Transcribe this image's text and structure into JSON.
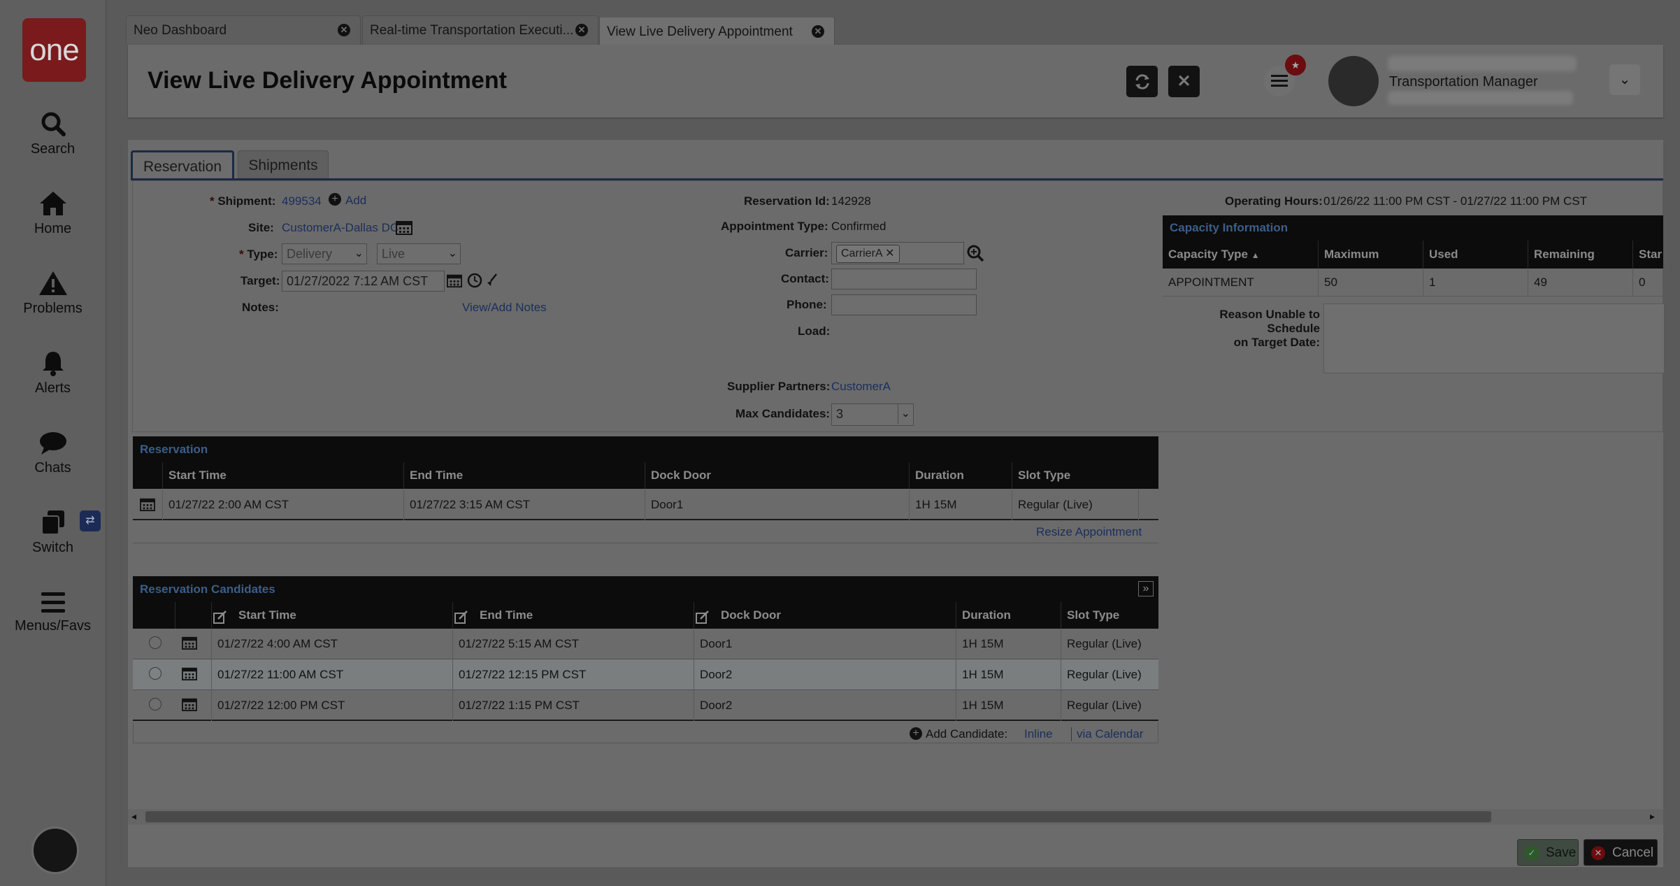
{
  "nav": {
    "logo": "one",
    "items": [
      {
        "label": "Search",
        "icon": "search-icon"
      },
      {
        "label": "Home",
        "icon": "home-icon"
      },
      {
        "label": "Problems",
        "icon": "warning-icon"
      },
      {
        "label": "Alerts",
        "icon": "bell-icon"
      },
      {
        "label": "Chats",
        "icon": "chat-icon"
      },
      {
        "label": "Switch",
        "icon": "switch-icon"
      },
      {
        "label": "Menus/Favs",
        "icon": "menu-icon"
      }
    ]
  },
  "tabs": [
    {
      "label": "Neo Dashboard"
    },
    {
      "label": "Real-time Transportation Executi..."
    },
    {
      "label": "View Live Delivery Appointment"
    }
  ],
  "header": {
    "title": "View Live Delivery Appointment",
    "user_role": "Transportation Manager"
  },
  "subtabs": [
    "Reservation",
    "Shipments"
  ],
  "form": {
    "shipment_label": "Shipment:",
    "shipment_value": "499534",
    "add_label": "Add",
    "site_label": "Site:",
    "site_value": "CustomerA-Dallas DC",
    "type_label": "Type:",
    "type_value1": "Delivery",
    "type_value2": "Live",
    "target_label": "Target:",
    "target_value": "01/27/2022 7:12 AM CST",
    "notes_label": "Notes:",
    "notes_link": "View/Add Notes",
    "reservation_id_label": "Reservation Id:",
    "reservation_id_value": "142928",
    "appointment_type_label": "Appointment Type:",
    "appointment_type_value": "Confirmed",
    "carrier_label": "Carrier:",
    "carrier_value": "CarrierA",
    "contact_label": "Contact:",
    "phone_label": "Phone:",
    "load_label": "Load:",
    "supplier_label": "Supplier Partners:",
    "supplier_value": "CustomerA",
    "max_candidates_label": "Max Candidates:",
    "max_candidates_value": "3",
    "operating_hours_label": "Operating Hours:",
    "operating_hours_value": "01/26/22 11:00 PM CST - 01/27/22 11:00 PM CST",
    "reason_label_1": "Reason Unable to Schedule",
    "reason_label_2": "on Target Date:"
  },
  "capacity": {
    "title": "Capacity Information",
    "columns": [
      "Capacity Type",
      "Maximum",
      "Used",
      "Remaining",
      "Star"
    ],
    "row": [
      "APPOINTMENT",
      "50",
      "1",
      "49",
      "0"
    ]
  },
  "reservation": {
    "title": "Reservation",
    "columns": [
      "Start Time",
      "End Time",
      "Dock Door",
      "Duration",
      "Slot Type"
    ],
    "row": [
      "01/27/22 2:00 AM CST",
      "01/27/22 3:15 AM CST",
      "Door1",
      "1H 15M",
      "Regular (Live)"
    ],
    "resize_link": "Resize Appointment"
  },
  "candidates": {
    "title": "Reservation Candidates",
    "columns": [
      "Start Time",
      "End Time",
      "Dock Door",
      "Duration",
      "Slot Type"
    ],
    "rows": [
      [
        "01/27/22 4:00 AM CST",
        "01/27/22 5:15 AM CST",
        "Door1",
        "1H 15M",
        "Regular (Live)"
      ],
      [
        "01/27/22 11:00 AM CST",
        "01/27/22 12:15 PM CST",
        "Door2",
        "1H 15M",
        "Regular (Live)"
      ],
      [
        "01/27/22 12:00 PM CST",
        "01/27/22 1:15 PM CST",
        "Door2",
        "1H 15M",
        "Regular (Live)"
      ]
    ],
    "add_candidate_label": "Add Candidate:",
    "inline_link": "Inline",
    "calendar_link": "via Calendar"
  },
  "footer": {
    "save_label": "Save",
    "cancel_label": "Cancel"
  }
}
